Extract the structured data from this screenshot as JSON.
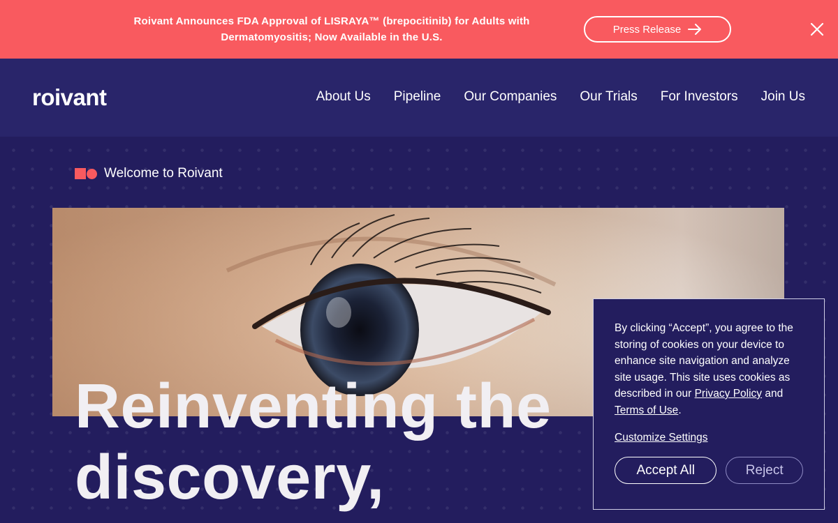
{
  "announcement": {
    "text": "Roivant Announces FDA Approval of LISRAYA™ (brepocitinib) for Adults with Dermatomyositis; Now Available in the U.S.",
    "button_label": "Press Release"
  },
  "header": {
    "logo": "roivant",
    "nav": [
      "About Us",
      "Pipeline",
      "Our Companies",
      "Our Trials",
      "For Investors",
      "Join Us"
    ]
  },
  "hero": {
    "eyebrow": "Welcome to Roivant",
    "headline_line1": "Reinventing the",
    "headline_line2": "discovery,"
  },
  "cookie_banner": {
    "text_before": "By clicking “Accept”, you agree to the storing of cookies on your device to enhance site navigation and analyze site usage. This site uses cookies as described in our ",
    "privacy_link": "Privacy Policy",
    "and": " and ",
    "terms_link": "Terms of Use",
    "period": ".",
    "customize": "Customize Settings",
    "accept": "Accept All",
    "reject": "Reject"
  },
  "colors": {
    "announcement_bg": "#f95a5f",
    "header_bg": "#29256a",
    "hero_bg": "#231d5e",
    "accent": "#f95a5f"
  }
}
